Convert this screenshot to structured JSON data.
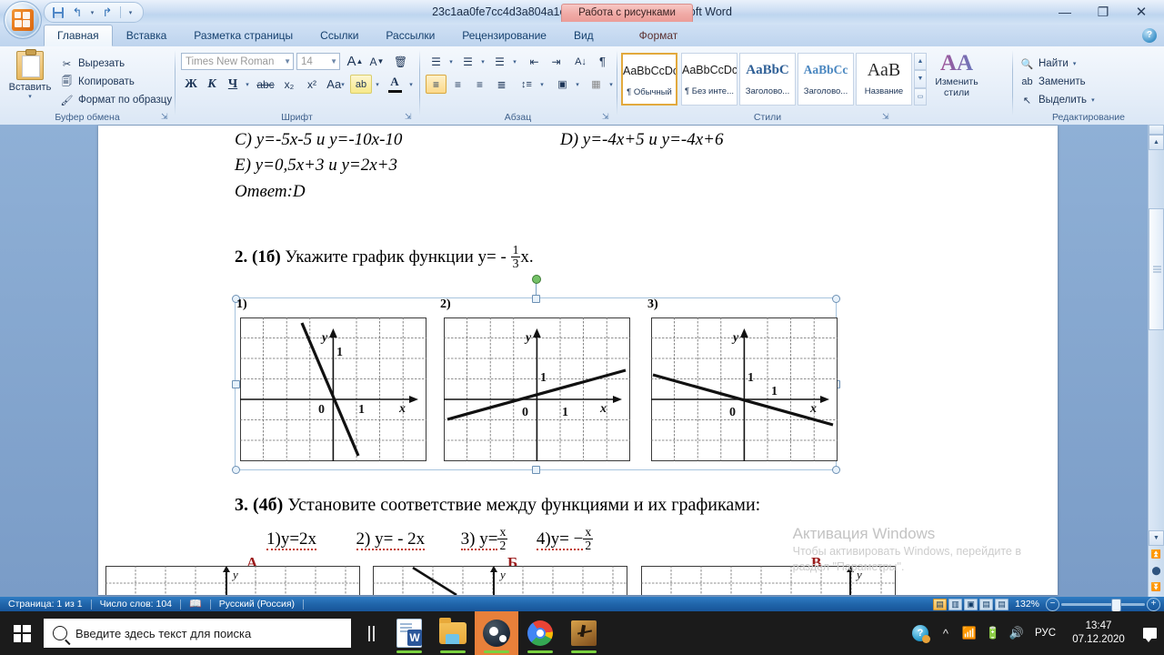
{
  "window": {
    "title": "23c1aa0fe7cc4d3a804a1c8b232284e0 (2) - Microsoft Word",
    "contextual_tab_banner": "Работа с рисунками",
    "minimize": "—",
    "maximize": "❐",
    "close": "✕",
    "help": "?"
  },
  "quick_access": {
    "save": "save-icon",
    "undo": "undo-icon",
    "undo_dropdown": "▾",
    "redo": "redo-icon",
    "customize": "▾"
  },
  "tabs": [
    {
      "label": "Главная",
      "active": true
    },
    {
      "label": "Вставка",
      "active": false
    },
    {
      "label": "Разметка страницы",
      "active": false
    },
    {
      "label": "Ссылки",
      "active": false
    },
    {
      "label": "Рассылки",
      "active": false
    },
    {
      "label": "Рецензирование",
      "active": false
    },
    {
      "label": "Вид",
      "active": false
    },
    {
      "label": "Формат",
      "active": false,
      "contextual": true
    }
  ],
  "ribbon": {
    "clipboard": {
      "title": "Буфер обмена",
      "paste": "Вставить",
      "cut": "Вырезать",
      "copy": "Копировать",
      "format_painter": "Формат по образцу"
    },
    "font": {
      "title": "Шрифт",
      "font_name": "Times New Roman",
      "font_size": "14",
      "grow": "A",
      "shrink": "A",
      "clear_format": "clear-formatting-icon",
      "bold": "Ж",
      "italic": "К",
      "underline": "Ч",
      "strikethrough": "abc",
      "subscript": "x₂",
      "superscript": "x²",
      "change_case": "Aa",
      "highlight": "ab",
      "font_color": "A"
    },
    "paragraph": {
      "title": "Абзац",
      "bullets": "bullet-list-icon",
      "numbering": "numbered-list-icon",
      "multilevel": "multilevel-list-icon",
      "decrease_indent": "decrease-indent-icon",
      "increase_indent": "increase-indent-icon",
      "sort": "sort-icon",
      "show_marks": "¶",
      "align_left": "align-left-icon",
      "align_center": "align-center-icon",
      "align_right": "align-right-icon",
      "justify": "justify-icon",
      "line_spacing": "line-spacing-icon",
      "shading": "shading-icon",
      "borders": "borders-icon"
    },
    "styles": {
      "title": "Стили",
      "items": [
        {
          "sample": "AaBbCcDc",
          "name": "¶ Обычный",
          "active": true
        },
        {
          "sample": "AaBbCcDc",
          "name": "¶ Без инте...",
          "active": false
        },
        {
          "sample": "AaBbC",
          "name": "Заголово...",
          "active": false
        },
        {
          "sample": "AaBbCc",
          "name": "Заголово...",
          "active": false
        },
        {
          "sample": "АаВ",
          "name": "Название",
          "active": false
        }
      ],
      "change_styles_line1": "Изменить",
      "change_styles_line2": "стили"
    },
    "editing": {
      "title": "Редактирование",
      "find": "Найти",
      "replace": "Заменить",
      "select": "Выделить"
    }
  },
  "document": {
    "line_c": "C) y=-5x-5 и y=-10x-10",
    "line_d": "D) y=-4x+5 и y=-4x+6",
    "line_e": "E) y=0,5x+3 и y=2x+3",
    "answer": "Ответ:D",
    "task2_number": "2. (1б)",
    "task2_text": "Укажите график функции y= - ",
    "task2_frac_num": "1",
    "task2_frac_den": "3",
    "task2_tail": "x.",
    "graph_labels": [
      "1)",
      "2)",
      "3)"
    ],
    "axis_y": "y",
    "axis_x": "x",
    "axis_one": "1",
    "axis_zero": "0",
    "task3_number": "3. (4б)",
    "task3_text": "Установите соответствие между функциями и их графиками:",
    "task3_opt1": "1)y=2x",
    "task3_opt2": "2) y= - 2x",
    "task3_opt3_pre": "3) y=",
    "task3_opt3_num": "x",
    "task3_opt3_den": "2",
    "task3_opt4_pre": "4)y=  −",
    "task3_opt4_num": "x",
    "task3_opt4_den": "2",
    "row_letters": [
      "А",
      "Б",
      "В"
    ]
  },
  "watermark": {
    "title": "Активация Windows",
    "line1": "Чтобы активировать Windows, перейдите в",
    "line2": "раздел \"Параметры\"."
  },
  "statusbar": {
    "page": "Страница: 1 из 1",
    "words": "Число слов: 104",
    "proofing": "proofing-errors-icon",
    "language": "Русский (Россия)",
    "views": [
      "print-layout-icon",
      "full-screen-reading-icon",
      "web-layout-icon",
      "outline-icon",
      "draft-icon"
    ],
    "zoom": "132%",
    "zoom_out": "−",
    "zoom_in": "+"
  },
  "taskbar": {
    "start": "windows-logo-icon",
    "search_placeholder": "Введите здесь текст для поиска",
    "task_view": "task-view-icon",
    "apps": [
      {
        "name": "word-taskbar-icon",
        "running": true
      },
      {
        "name": "file-explorer-taskbar-icon",
        "running": true
      },
      {
        "name": "steam-taskbar-icon",
        "running": true,
        "active": true
      },
      {
        "name": "chrome-taskbar-icon",
        "running": true
      },
      {
        "name": "counter-strike-taskbar-icon",
        "running": true
      }
    ],
    "tray": {
      "security": "security-notification-icon",
      "show_hidden": "^",
      "network": "wifi-icon",
      "battery": "battery-icon",
      "volume": "volume-icon",
      "language": "РУС",
      "time": "13:47",
      "date": "07.12.2020",
      "action_center": "action-center-icon"
    }
  },
  "colors": {
    "accent": "#2f7cc4",
    "contextual_tab": "#eb9d98",
    "red_letter": "#9b1b1b",
    "watermark": "#c8c8c8"
  }
}
